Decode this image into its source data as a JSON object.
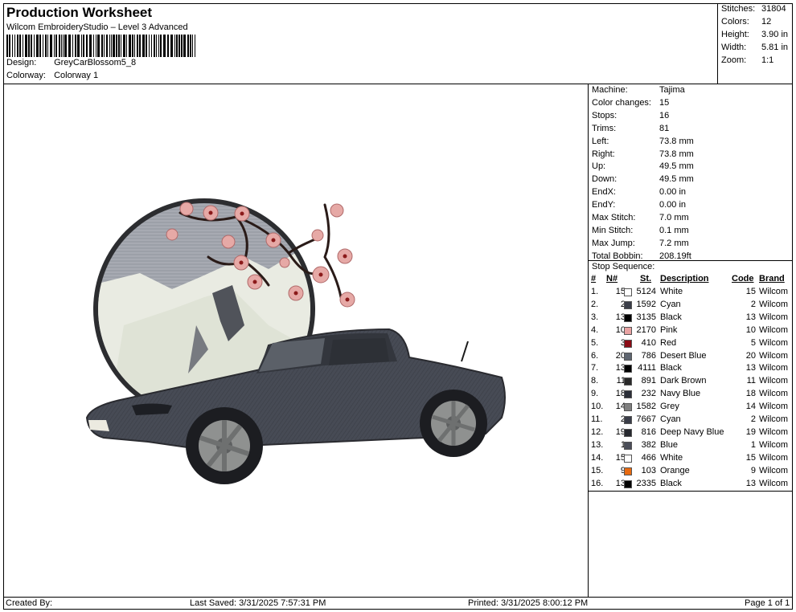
{
  "header": {
    "title": "Production Worksheet",
    "subtitle": "Wilcom EmbroideryStudio – Level 3 Advanced",
    "design_label": "Design:",
    "design_value": "GreyCarBlossom5_8",
    "colorway_label": "Colorway:",
    "colorway_value": "Colorway 1"
  },
  "stats": {
    "stitches_label": "Stitches:",
    "stitches_value": "31804",
    "colors_label": "Colors:",
    "colors_value": "12",
    "height_label": "Height:",
    "height_value": "3.90 in",
    "width_label": "Width:",
    "width_value": "5.81 in",
    "zoom_label": "Zoom:",
    "zoom_value": "1:1"
  },
  "info": [
    {
      "k": "Machine:",
      "v": "Tajima"
    },
    {
      "k": "Color changes:",
      "v": "15"
    },
    {
      "k": "Stops:",
      "v": "16"
    },
    {
      "k": "Trims:",
      "v": "81"
    },
    {
      "k": "Left:",
      "v": "73.8 mm"
    },
    {
      "k": "Right:",
      "v": "73.8 mm"
    },
    {
      "k": "Up:",
      "v": "49.5 mm"
    },
    {
      "k": "Down:",
      "v": "49.5 mm"
    },
    {
      "k": "EndX:",
      "v": "0.00 in"
    },
    {
      "k": "EndY:",
      "v": "0.00 in"
    },
    {
      "k": "Max Stitch:",
      "v": "7.0 mm"
    },
    {
      "k": "Min Stitch:",
      "v": "0.1 mm"
    },
    {
      "k": "Max Jump:",
      "v": "7.2 mm"
    },
    {
      "k": "Total Bobbin:",
      "v": "208.19ft"
    }
  ],
  "stop_sequence": {
    "label": "Stop Sequence:",
    "headers": {
      "idx": "#",
      "num": "N#",
      "st": "St.",
      "desc": "Description",
      "code": "Code",
      "brand": "Brand"
    },
    "rows": [
      {
        "idx": "1.",
        "num": "15",
        "color": "#ffffff",
        "st": "5124",
        "desc": "White",
        "code": "15",
        "brand": "Wilcom"
      },
      {
        "idx": "2.",
        "num": "2",
        "color": "#3a3d48",
        "st": "1592",
        "desc": "Cyan",
        "code": "2",
        "brand": "Wilcom"
      },
      {
        "idx": "3.",
        "num": "13",
        "color": "#000000",
        "st": "3135",
        "desc": "Black",
        "code": "13",
        "brand": "Wilcom"
      },
      {
        "idx": "4.",
        "num": "10",
        "color": "#e9a3a3",
        "st": "2170",
        "desc": "Pink",
        "code": "10",
        "brand": "Wilcom"
      },
      {
        "idx": "5.",
        "num": "3",
        "color": "#8b0a14",
        "st": "410",
        "desc": "Red",
        "code": "5",
        "brand": "Wilcom"
      },
      {
        "idx": "6.",
        "num": "20",
        "color": "#5e6570",
        "st": "786",
        "desc": "Desert Blue",
        "code": "20",
        "brand": "Wilcom"
      },
      {
        "idx": "7.",
        "num": "13",
        "color": "#000000",
        "st": "4111",
        "desc": "Black",
        "code": "13",
        "brand": "Wilcom"
      },
      {
        "idx": "8.",
        "num": "11",
        "color": "#2a2a2a",
        "st": "891",
        "desc": "Dark Brown",
        "code": "11",
        "brand": "Wilcom"
      },
      {
        "idx": "9.",
        "num": "18",
        "color": "#2b2e38",
        "st": "232",
        "desc": "Navy Blue",
        "code": "18",
        "brand": "Wilcom"
      },
      {
        "idx": "10.",
        "num": "14",
        "color": "#808080",
        "st": "1582",
        "desc": "Grey",
        "code": "14",
        "brand": "Wilcom"
      },
      {
        "idx": "11.",
        "num": "2",
        "color": "#3a3d48",
        "st": "7667",
        "desc": "Cyan",
        "code": "2",
        "brand": "Wilcom"
      },
      {
        "idx": "12.",
        "num": "19",
        "color": "#26282e",
        "st": "816",
        "desc": "Deep Navy Blue",
        "code": "19",
        "brand": "Wilcom"
      },
      {
        "idx": "13.",
        "num": "1",
        "color": "#4a4d58",
        "st": "382",
        "desc": "Blue",
        "code": "1",
        "brand": "Wilcom"
      },
      {
        "idx": "14.",
        "num": "15",
        "color": "#ffffff",
        "st": "466",
        "desc": "White",
        "code": "15",
        "brand": "Wilcom"
      },
      {
        "idx": "15.",
        "num": "9",
        "color": "#e86a10",
        "st": "103",
        "desc": "Orange",
        "code": "9",
        "brand": "Wilcom"
      },
      {
        "idx": "16.",
        "num": "13",
        "color": "#000000",
        "st": "2335",
        "desc": "Black",
        "code": "13",
        "brand": "Wilcom"
      }
    ]
  },
  "footer": {
    "created_by": "Created By:",
    "last_saved": "Last Saved: 3/31/2025 7:57:31 PM",
    "printed": "Printed: 3/31/2025 8:00:12 PM",
    "page": "Page 1 of 1"
  }
}
